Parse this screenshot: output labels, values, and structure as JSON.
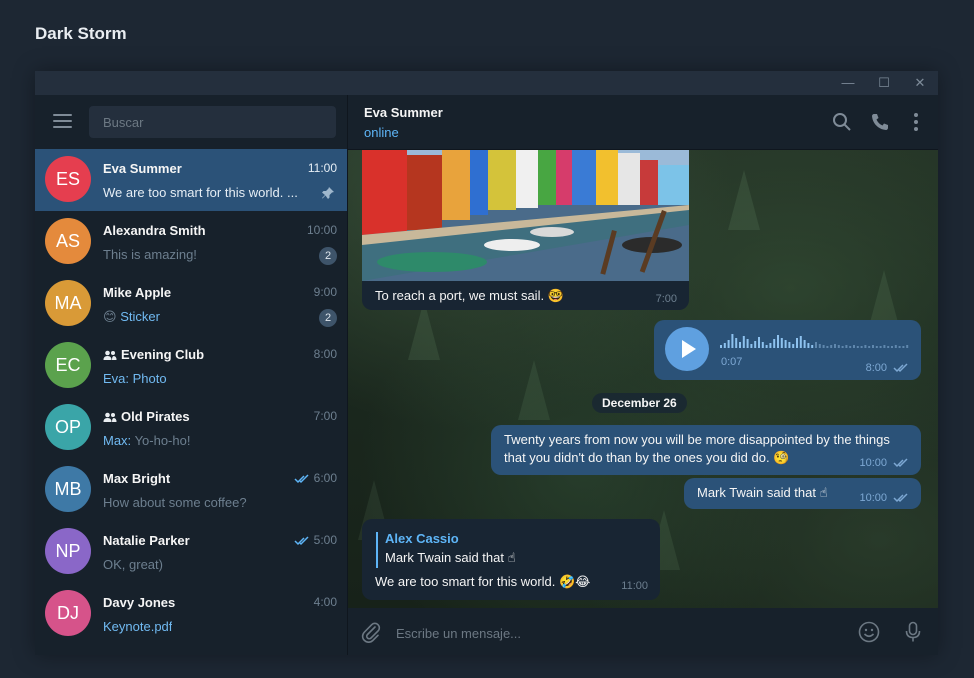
{
  "app": {
    "title": "Dark Storm"
  },
  "window": {
    "minimize": "—",
    "maximize": "☐",
    "close": "✕"
  },
  "search": {
    "placeholder": "Buscar"
  },
  "chats": [
    {
      "initials": "ES",
      "color": "#e53e4f",
      "name": "Eva Summer",
      "time": "11:00",
      "preview": "We are too smart for this world. ...",
      "pinned": true,
      "active": true
    },
    {
      "initials": "AS",
      "color": "#e48a3c",
      "name": "Alexandra Smith",
      "time": "10:00",
      "preview": "This is amazing!",
      "badge": "2"
    },
    {
      "initials": "MA",
      "color": "#d99a37",
      "name": "Mike Apple",
      "time": "9:00",
      "preview_emoji": "😊",
      "preview_accent": "Sticker",
      "badge": "2"
    },
    {
      "initials": "EC",
      "color": "#5ba24d",
      "name": "Evening Club",
      "group": true,
      "time": "8:00",
      "preview_sender": "Eva:",
      "preview_accent": "Photo"
    },
    {
      "initials": "OP",
      "color": "#3aa5a8",
      "name": "Old Pirates",
      "group": true,
      "time": "7:00",
      "preview_sender": "Max:",
      "preview": "Yo-ho-ho!"
    },
    {
      "initials": "MB",
      "color": "#3e79a6",
      "name": "Max Bright",
      "time": "6:00",
      "read": true,
      "preview": "How about some coffee?"
    },
    {
      "initials": "NP",
      "color": "#8a67c8",
      "name": "Natalie Parker",
      "time": "5:00",
      "read": true,
      "preview": "OK, great)"
    },
    {
      "initials": "DJ",
      "color": "#d6538a",
      "name": "Davy Jones",
      "time": "4:00",
      "preview_accent": "Keynote.pdf"
    }
  ],
  "conversation": {
    "peer_name": "Eva Summer",
    "peer_status": "online",
    "photo_caption": "To reach a port, we must sail. 🤓",
    "photo_time": "7:00",
    "voice_duration": "0:07",
    "voice_time": "8:00",
    "voice_waveform": [
      3,
      5,
      8,
      14,
      10,
      6,
      12,
      9,
      4,
      7,
      11,
      6,
      3,
      5,
      9,
      13,
      10,
      8,
      6,
      4,
      10,
      12,
      8,
      5,
      3,
      6,
      4,
      3,
      2,
      3,
      4,
      3,
      2,
      3,
      2,
      3,
      2,
      2,
      3,
      2,
      3,
      2,
      2,
      3,
      2,
      2,
      3,
      2,
      2,
      3
    ],
    "date_separator": "December 26",
    "out1_line1": "Twenty years from now you will be more disappointed by the things",
    "out1_line2": "that you didn't do than by the ones you did do. 🧐",
    "out1_time": "10:00",
    "out2_text": "Mark Twain said that ☝",
    "out2_time": "10:00",
    "reply_author": "Alex Cassio",
    "reply_text": "Mark Twain said that ☝",
    "in_text": "We are too smart for this world. 🤣😂",
    "in_time": "11:00"
  },
  "composer": {
    "placeholder": "Escribe un mensaje..."
  },
  "colors": {
    "accent": "#5eb5f7",
    "active_chat": "#2b5278",
    "bubble_out": "#2b5278",
    "bubble_in": "#182533",
    "sidebar": "#17212b"
  }
}
